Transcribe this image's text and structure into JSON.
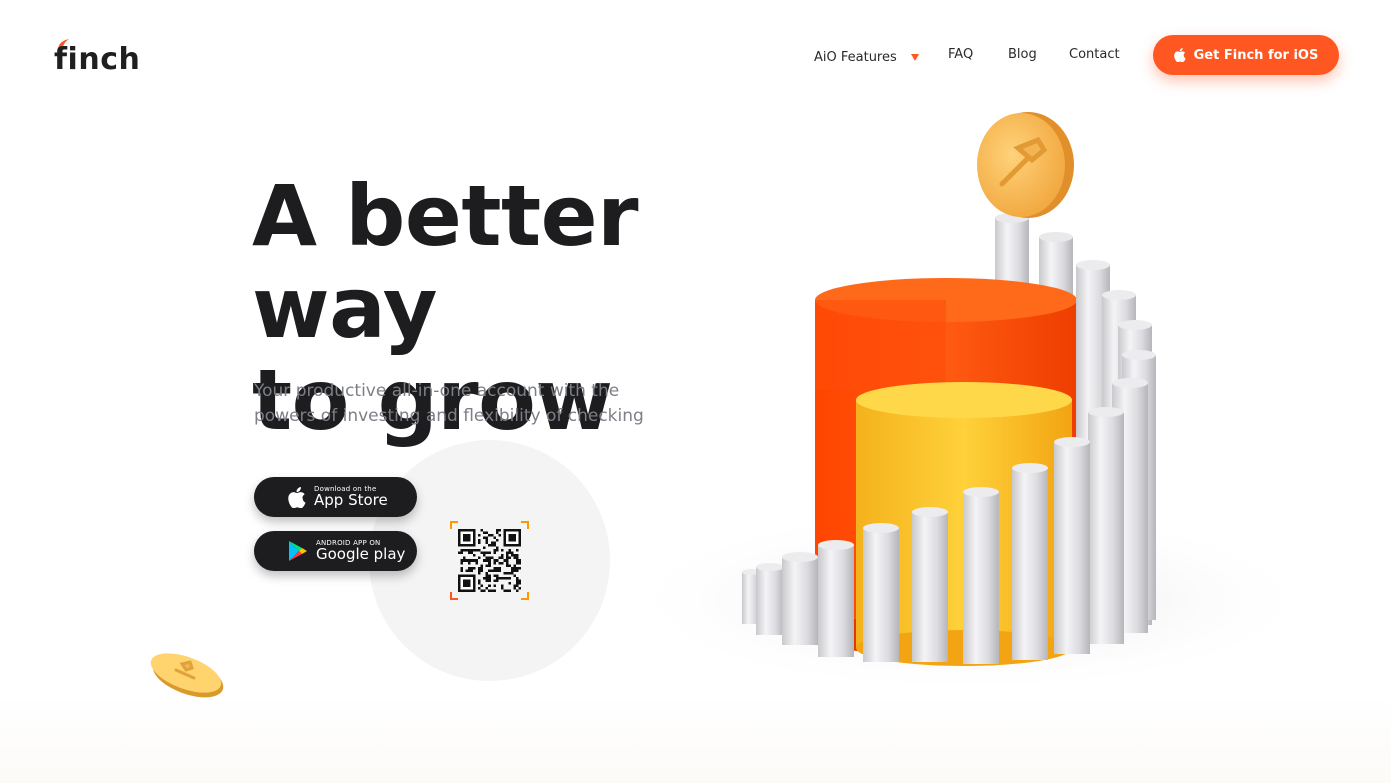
{
  "brand": {
    "name": "finch",
    "accent": "#ff5722",
    "accent_light": "#ff9800",
    "dark": "#1d1d1f"
  },
  "nav": {
    "items": [
      {
        "label": "AiO Features",
        "has_dropdown": true
      },
      {
        "label": "FAQ"
      },
      {
        "label": "Blog"
      },
      {
        "label": "Contact"
      }
    ],
    "cta": {
      "label": "Get Finch for iOS",
      "icon": "apple-icon"
    }
  },
  "hero": {
    "title": "A better way\nto grow",
    "subtitle": "Your productive all-in-one account with the powers of investing and flexibility of checking"
  },
  "downloads": {
    "app_store": {
      "small": "Download on the",
      "big": "App Store",
      "icon": "apple-icon"
    },
    "google_play": {
      "small": "ANDROID APP ON",
      "big": "Google play",
      "icon": "google-play-icon"
    },
    "qr": {
      "icon": "qr-code-icon"
    }
  },
  "illustration": {
    "description_icon": "growth-chart-illustration"
  }
}
